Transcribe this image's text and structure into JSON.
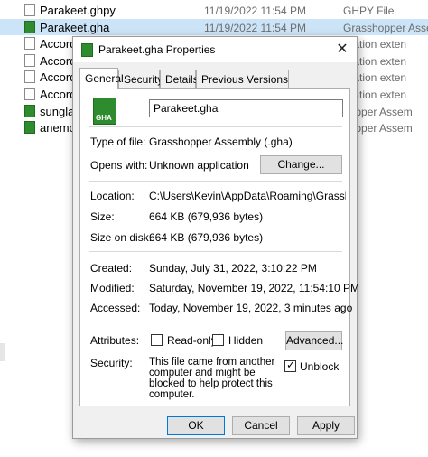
{
  "explorer": {
    "rows": [
      {
        "name": "Parakeet.ghpy",
        "date": "11/19/2022 11:54 PM",
        "type": "GHPY File",
        "icon": "file-icon",
        "selected": false
      },
      {
        "name": "Parakeet.gha",
        "date": "11/19/2022 11:54 PM",
        "type": "Grasshopper Assem",
        "icon": "gha-file-icon",
        "selected": true
      },
      {
        "name": "Accord.",
        "date": "",
        "type": "lication exten",
        "icon": "file-icon",
        "selected": false
      },
      {
        "name": "Accord.",
        "date": "",
        "type": "lication exten",
        "icon": "file-icon",
        "selected": false
      },
      {
        "name": "Accord.",
        "date": "",
        "type": "lication exten",
        "icon": "file-icon",
        "selected": false
      },
      {
        "name": "Accord.",
        "date": "",
        "type": "lication exten",
        "icon": "file-icon",
        "selected": false
      },
      {
        "name": "sunglass",
        "date": "",
        "type": "hopper Assem",
        "icon": "gha-file-icon",
        "selected": false
      },
      {
        "name": "anemor",
        "date": "",
        "type": "hopper Assem",
        "icon": "gha-file-icon",
        "selected": false
      }
    ]
  },
  "dialog": {
    "title": "Parakeet.gha Properties",
    "close_glyph": "✕",
    "tabs": [
      "General",
      "Security",
      "Details",
      "Previous Versions"
    ],
    "active_tab": "General",
    "file_name": "Parakeet.gha",
    "icon_caption": "GHA",
    "type_label": "Type of file:",
    "type_value": "Grasshopper Assembly (.gha)",
    "opens_label": "Opens with:",
    "opens_value": "Unknown application",
    "change_button": "Change...",
    "location_label": "Location:",
    "location_value": "C:\\Users\\Kevin\\AppData\\Roaming\\Grasshopper\\Li",
    "size_label": "Size:",
    "size_value": "664 KB (679,936 bytes)",
    "size_on_disk_label": "Size on disk:",
    "size_on_disk_value": "664 KB (679,936 bytes)",
    "created_label": "Created:",
    "created_value": "Sunday, July 31, 2022, 3:10:22 PM",
    "modified_label": "Modified:",
    "modified_value": "Saturday, November 19, 2022, 11:54:10 PM",
    "accessed_label": "Accessed:",
    "accessed_value": "Today, November 19, 2022, 3 minutes ago",
    "attributes_label": "Attributes:",
    "readonly_label": "Read-only",
    "readonly_checked": false,
    "hidden_label": "Hidden",
    "hidden_checked": false,
    "advanced_button": "Advanced...",
    "security_label": "Security:",
    "security_text": "This file came from another computer and might be blocked to help protect this computer.",
    "unblock_label": "Unblock",
    "unblock_checked": true,
    "ok_button": "OK",
    "cancel_button": "Cancel",
    "apply_button": "Apply",
    "highlight_color": "#ffff00",
    "selection_color": "#cce4f7"
  }
}
